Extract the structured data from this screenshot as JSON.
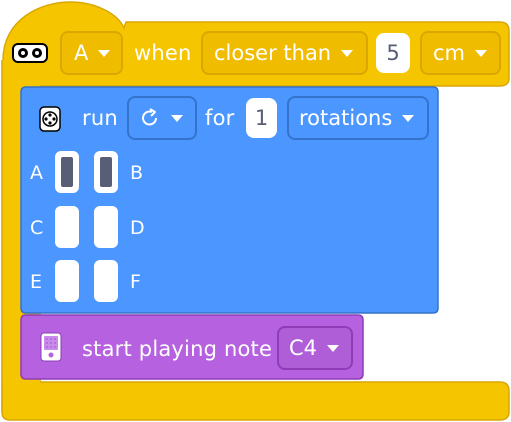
{
  "event_block": {
    "colors": {
      "fill": "#F5C500",
      "stroke": "#D9A700"
    },
    "icon": "distance-sensor-icon",
    "port": "A",
    "when_label": "when",
    "condition": "closer than",
    "value": "5",
    "unit": "cm"
  },
  "motor_block": {
    "colors": {
      "fill": "#4C97FF",
      "stroke": "#3373CC"
    },
    "icon": "motor-icon",
    "run_label": "run",
    "direction_icon": "clockwise-arrow-icon",
    "for_label": "for",
    "amount": "1",
    "unit": "rotations",
    "ports": [
      {
        "letter": "A",
        "selected": true
      },
      {
        "letter": "B",
        "selected": true
      },
      {
        "letter": "C",
        "selected": false
      },
      {
        "letter": "D",
        "selected": false
      },
      {
        "letter": "E",
        "selected": false
      },
      {
        "letter": "F",
        "selected": false
      }
    ]
  },
  "sound_block": {
    "colors": {
      "fill": "#B561E0",
      "stroke": "#8E3DB6"
    },
    "icon": "hub-speaker-icon",
    "label": "start playing note",
    "note": "C4"
  }
}
